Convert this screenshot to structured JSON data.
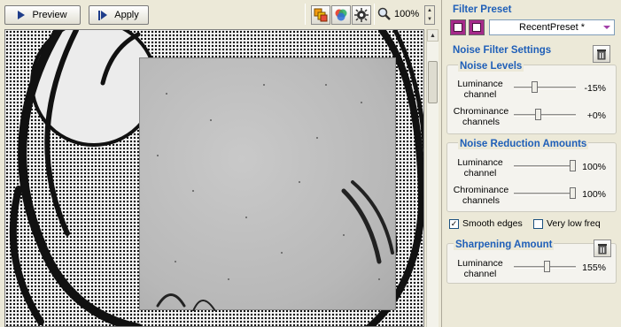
{
  "toolbar": {
    "preview_label": "Preview",
    "apply_label": "Apply",
    "zoom_value": "100%",
    "icons": [
      "layers-icon",
      "color-wheel-icon",
      "settings-gear-icon",
      "magnifier-icon"
    ]
  },
  "panel": {
    "filter_preset_title": "Filter Preset",
    "preset_value": "RecentPreset *",
    "noise_filter_title": "Noise Filter Settings",
    "noise_levels": {
      "title": "Noise Levels",
      "luminance_label": "Luminance channel",
      "luminance_value": "-15%",
      "chrominance_label": "Chrominance channels",
      "chrominance_value": "+0%"
    },
    "reduction": {
      "title": "Noise Reduction Amounts",
      "luminance_label": "Luminance channel",
      "luminance_value": "100%",
      "chrominance_label": "Chrominance channels",
      "chrominance_value": "100%"
    },
    "smooth_edges_label": "Smooth edges",
    "smooth_edges_checked": true,
    "low_freq_label": "Very low freq",
    "low_freq_checked": false,
    "sharpening": {
      "title": "Sharpening Amount",
      "luminance_label": "Luminance channel",
      "luminance_value": "155%"
    }
  },
  "colors": {
    "accent": "#1f5fb8",
    "preset_button": "#a52a8a"
  }
}
